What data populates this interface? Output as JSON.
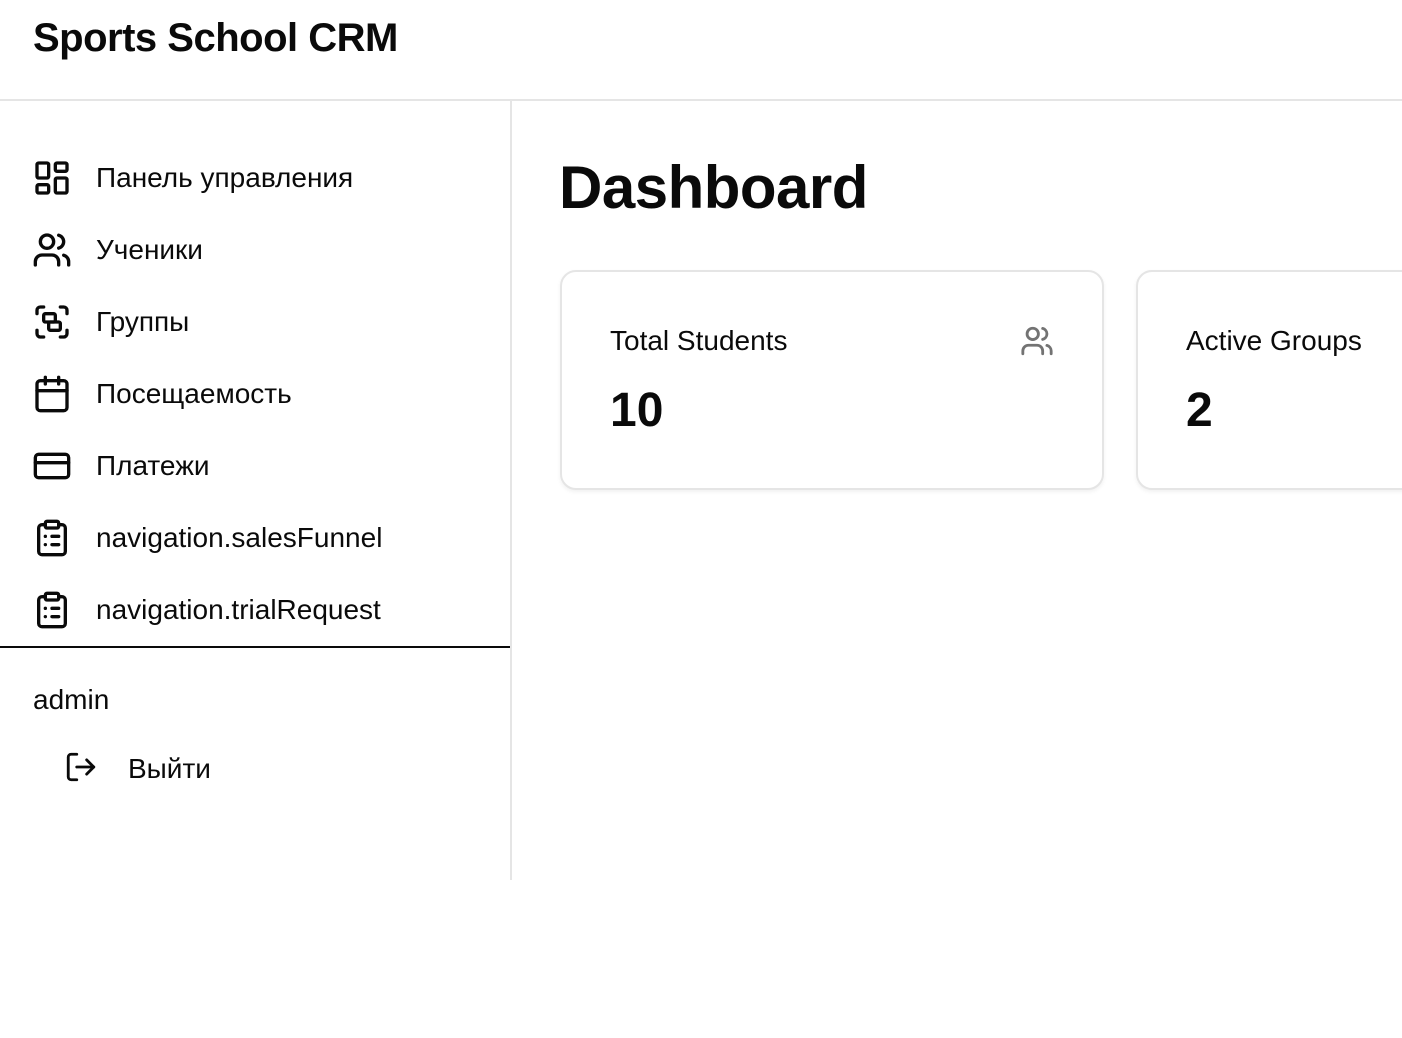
{
  "app": {
    "title": "Sports School CRM"
  },
  "sidebar": {
    "items": [
      {
        "label": "Панель управления",
        "icon": "layout-dashboard-icon"
      },
      {
        "label": "Ученики",
        "icon": "users-icon"
      },
      {
        "label": "Группы",
        "icon": "group-icon"
      },
      {
        "label": "Посещаемость",
        "icon": "calendar-icon"
      },
      {
        "label": "Платежи",
        "icon": "credit-card-icon"
      },
      {
        "label": "navigation.salesFunnel",
        "icon": "clipboard-list-icon"
      },
      {
        "label": "navigation.trialRequest",
        "icon": "clipboard-list-icon"
      }
    ],
    "user": {
      "name": "admin"
    },
    "logout": {
      "label": "Выйти",
      "icon": "log-out-icon"
    }
  },
  "main": {
    "title": "Dashboard",
    "cards": [
      {
        "label": "Total Students",
        "value": "10",
        "icon": "users-icon"
      },
      {
        "label": "Active Groups",
        "value": "2"
      }
    ]
  },
  "colors": {
    "text": "#0a0a0a",
    "border": "#e5e5e5",
    "muted_icon": "#737373",
    "background": "#ffffff"
  }
}
